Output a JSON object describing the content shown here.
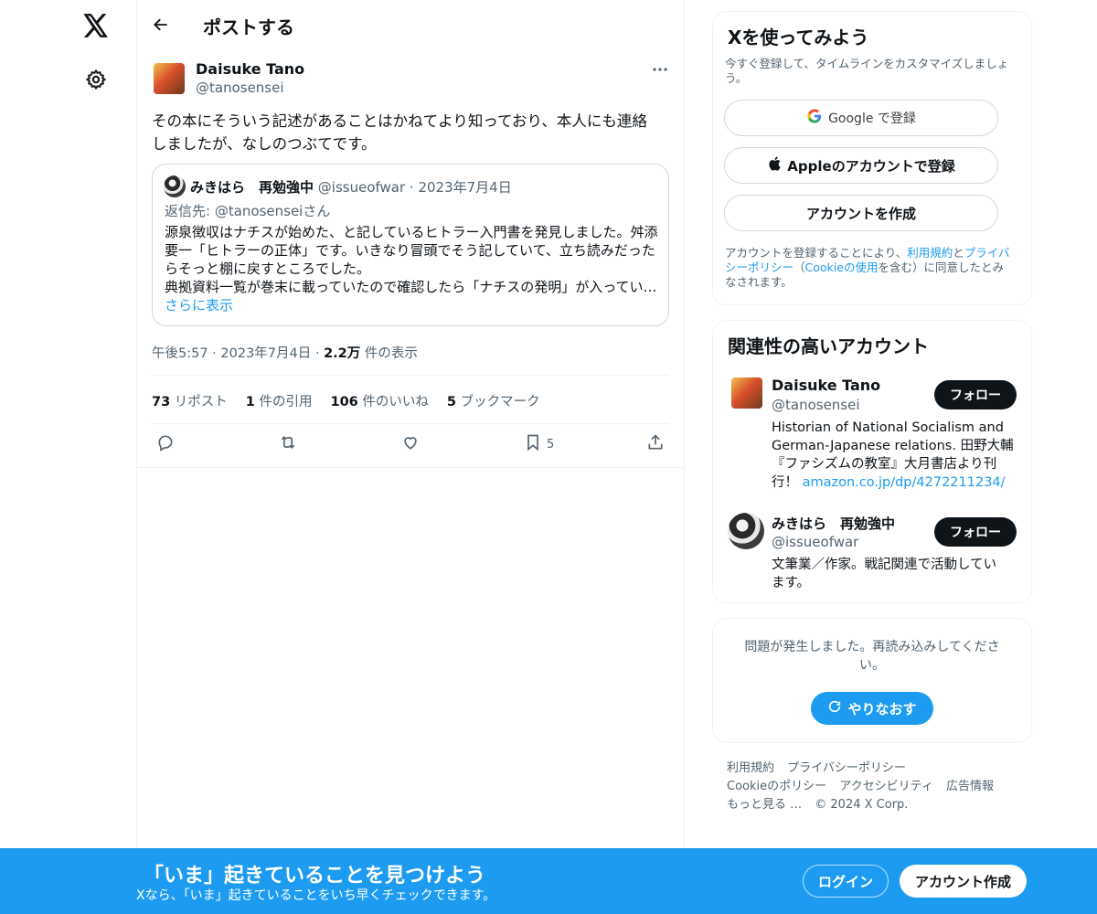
{
  "header": {
    "title": "ポストする"
  },
  "tweet": {
    "author_name": "Daisuke Tano",
    "author_handle": "@tanosensei",
    "text_line1": "その本にそういう記述があることはかねてより知っており、本人にも連絡",
    "text_line2": "しましたが、なしのつぶてです。",
    "time": "午後5:57",
    "date": "2023年7月4日",
    "views_count": "2.2万",
    "views_label": " 件の表示"
  },
  "quote": {
    "author_name": "みきはら　再勉強中",
    "author_handle": "@issueofwar",
    "date": "2023年7月4日",
    "reply_to": "返信先: @tanosenseiさん",
    "line1": "源泉徴収はナチスが始めた、と記しているヒトラー入門書を発見しました。舛添",
    "line2": "要一「ヒトラーの正体」です。いきなり冒頭でそう記していて、立ち読みだった",
    "line3": "らそっと棚に戻すところでした。",
    "line4": "典拠資料一覧が巻末に載っていたので確認したら「ナチスの発明」が入ってい…",
    "show_more": "さらに表示"
  },
  "stats": [
    {
      "count": "73",
      "label": " リポスト"
    },
    {
      "count": "1",
      "label": " 件の引用"
    },
    {
      "count": "106",
      "label": " 件のいいね"
    },
    {
      "count": "5",
      "label": " ブックマーク"
    }
  ],
  "actions": {
    "bookmark_count": "5"
  },
  "signup": {
    "title": "Xを使ってみよう",
    "subtitle_line1": "今すぐ登録して、タイムラインをカスタマイズしましょ",
    "subtitle_line2": "う。",
    "google_label": "Google で登録",
    "apple_label": "Appleのアカウントで登録",
    "create_label": "アカウントを作成",
    "terms_pre": "アカウントを登録することにより、",
    "terms_link": "利用規約",
    "terms_and": "と",
    "privacy_link1": "プライバ",
    "privacy_link2": "シーポリシー",
    "paren_open": "（",
    "cookie_link": "Cookieの使用",
    "terms_post1": "を含む）に同意したとみ",
    "terms_post2": "なされます。"
  },
  "related": {
    "title": "関連性の高いアカウント",
    "accounts": [
      {
        "name": "Daisuke Tano",
        "handle": "@tanosensei",
        "follow": "フォロー",
        "bio_line1": "Historian of National Socialism and",
        "bio_line2": "German-Japanese relations. 田野大輔",
        "bio_line3": "『ファシズムの教室』大月書店より刊",
        "bio_line4_pre": "行！ ",
        "bio_link": "amazon.co.jp/dp/4272211234/"
      },
      {
        "name": "みきはら　再勉強中",
        "handle": "@issueofwar",
        "follow": "フォロー",
        "bio_line1": "文筆業／作家。戦記関連で活動してい",
        "bio_line2": "ます。"
      }
    ]
  },
  "error": {
    "line1": "問題が発生しました。再読み込みしてくださ",
    "line2": "い。",
    "retry": "やりなおす"
  },
  "footer": {
    "links_row1": [
      "利用規約",
      "プライバシーポリシー"
    ],
    "links_row2": [
      "Cookieのポリシー",
      "アクセシビリティ",
      "広告情報"
    ],
    "more": "もっと見る …",
    "copyright": "© 2024 X Corp."
  },
  "bottom_bar": {
    "title": "「いま」起きていることを見つけよう",
    "subtitle": "Xなら、「いま」起きていることをいち早くチェックできます。",
    "login": "ログイン",
    "signup": "アカウント作成"
  },
  "colors": {
    "accent": "#1d9bf0",
    "text": "#0f1419",
    "muted": "#536471",
    "border": "#eff3f4"
  }
}
